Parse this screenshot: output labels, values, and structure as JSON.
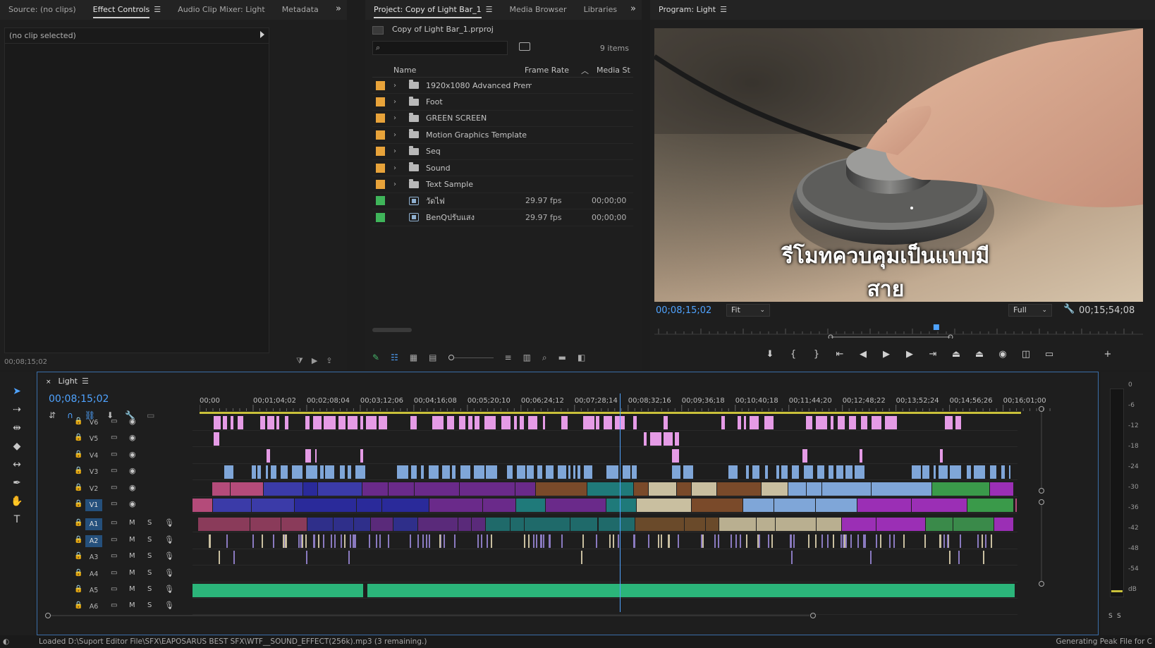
{
  "source_panel": {
    "tabs": [
      "Source: (no clips)",
      "Effect Controls",
      "Audio Clip Mixer: Light",
      "Metadata"
    ],
    "active_tab": "Effect Controls",
    "no_clip_text": "(no clip selected)",
    "timecode": "00;08;15;02"
  },
  "project_panel": {
    "tabs": [
      "Project: Copy of Light Bar_1",
      "Media Browser",
      "Libraries"
    ],
    "filename": "Copy of Light Bar_1.prproj",
    "search_placeholder": "",
    "item_count": "9 items",
    "columns": {
      "name": "Name",
      "frame_rate": "Frame Rate",
      "media_start": "Media St"
    },
    "items": [
      {
        "type": "folder",
        "name": "1920x1080 Advanced Prem",
        "color": "#e8a33a",
        "frame_rate": "",
        "media_start": ""
      },
      {
        "type": "folder",
        "name": "Foot",
        "color": "#e8a33a",
        "frame_rate": "",
        "media_start": ""
      },
      {
        "type": "folder",
        "name": "GREEN SCREEN",
        "color": "#e8a33a",
        "frame_rate": "",
        "media_start": ""
      },
      {
        "type": "folder",
        "name": "Motion Graphics Template",
        "color": "#e8a33a",
        "frame_rate": "",
        "media_start": ""
      },
      {
        "type": "folder",
        "name": "Seq",
        "color": "#e8a33a",
        "frame_rate": "",
        "media_start": ""
      },
      {
        "type": "folder",
        "name": "Sound",
        "color": "#e8a33a",
        "frame_rate": "",
        "media_start": ""
      },
      {
        "type": "folder",
        "name": "Text Sample",
        "color": "#e8a33a",
        "frame_rate": "",
        "media_start": ""
      },
      {
        "type": "sequence",
        "name": "วัดไฟ",
        "color": "#3fb55a",
        "frame_rate": "29.97 fps",
        "media_start": "00;00;00"
      },
      {
        "type": "sequence",
        "name": "BenQปรับแสง",
        "color": "#3fb55a",
        "frame_rate": "29.97 fps",
        "media_start": "00;00;00"
      }
    ]
  },
  "program_panel": {
    "title": "Program: Light",
    "subtitle_text": "รีโมทควบคุมเป็นแบบมีสาย",
    "current_timecode": "00;08;15;02",
    "zoom": "Fit",
    "resolution": "Full",
    "duration": "00;15;54;08",
    "playhead_fraction": 0.5
  },
  "timeline": {
    "tab_title": "Light",
    "timecode": "00;08;15;02",
    "ruler_ticks": [
      "00;00",
      "00;01;04;02",
      "00;02;08;04",
      "00;03;12;06",
      "00;04;16;08",
      "00;05;20;10",
      "00;06;24;12",
      "00;07;28;14",
      "00;08;32;16",
      "00;09;36;18",
      "00;10;40;18",
      "00;11;44;20",
      "00;12;48;22",
      "00;13;52;24",
      "00;14;56;26",
      "00;16;01;00"
    ],
    "video_tracks": [
      "V6",
      "V5",
      "V4",
      "V3",
      "V2",
      "V1"
    ],
    "audio_tracks": [
      "A1",
      "A2",
      "A3",
      "A4",
      "A5",
      "A6"
    ],
    "mute_label": "M",
    "solo_label": "S",
    "playhead_fraction": 0.518
  },
  "meter": {
    "labels": [
      "0",
      "-6",
      "-12",
      "-18",
      "-24",
      "-30",
      "-36",
      "-42",
      "-48",
      "-54",
      "dB"
    ],
    "solo_labels": [
      "S",
      "S"
    ]
  },
  "status": {
    "left": "Loaded D:\\Suport Editor File\\SFX\\EAPOSARUS BEST SFX\\WTF__SOUND_EFFECT(256k).mp3 (3 remaining.)",
    "right": "Generating Peak File for C"
  },
  "colors": {
    "accent": "#4fa3ff",
    "v_pink": "#e59be6",
    "v_blue": "#7fa6d8",
    "v_violet": "#5a4fd6",
    "audio_green": "#2bb57a",
    "folder_label": "#e8a33a",
    "sequence_label": "#3fb55a"
  }
}
